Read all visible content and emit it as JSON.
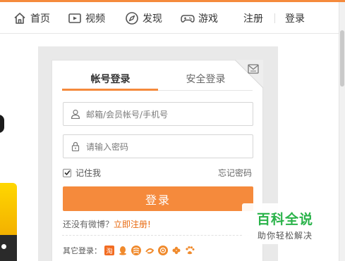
{
  "nav": {
    "items": [
      {
        "label": "首页",
        "icon": "home-icon"
      },
      {
        "label": "视频",
        "icon": "video-icon"
      },
      {
        "label": "发现",
        "icon": "discover-icon"
      },
      {
        "label": "游戏",
        "icon": "gamepad-icon"
      }
    ],
    "register": "注册",
    "login": "登录"
  },
  "login": {
    "tabs": [
      "帐号登录",
      "安全登录"
    ],
    "active_tab": "帐号登录",
    "username_placeholder": "邮箱/会员帐号/手机号",
    "password_placeholder": "请输入密码",
    "remember_me": "记住我",
    "remember_checked": true,
    "forgot_password": "忘记密码",
    "submit": "登录",
    "no_account": "还没有微博？",
    "register_now": "立即注册!",
    "other_login": "其它登录："
  },
  "other_login_icons": [
    "taobao-icon",
    "qq-icon",
    "weibo-icon",
    "alipay-icon",
    "renren-icon",
    "wangwang-icon",
    "baidu-icon"
  ],
  "watermark": {
    "title": "百科全说",
    "subtitle": "助你轻松解决"
  },
  "colors": {
    "accent": "#f58a3c",
    "link": "#e8690f",
    "watermark_green": "#2ab34a"
  }
}
